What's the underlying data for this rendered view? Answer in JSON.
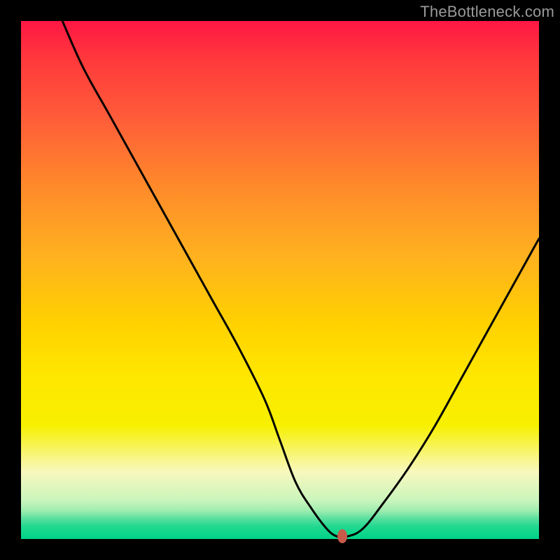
{
  "watermark": "TheBottleneck.com",
  "colors": {
    "frame": "#000000",
    "curve": "#000000",
    "marker": "#c85a4a",
    "gradient_top": "#ff1744",
    "gradient_bottom": "#00d488"
  },
  "chart_data": {
    "type": "line",
    "title": "",
    "xlabel": "",
    "ylabel": "",
    "xlim": [
      0,
      100
    ],
    "ylim": [
      0,
      100
    ],
    "grid": false,
    "x": [
      8,
      12,
      17,
      22,
      27,
      32,
      37,
      42,
      47,
      50,
      53,
      56,
      59,
      61,
      63,
      66,
      70,
      75,
      80,
      85,
      90,
      95,
      100
    ],
    "values": [
      100,
      91,
      82,
      73,
      64,
      55,
      46,
      37,
      27,
      19,
      11,
      6,
      2,
      0.5,
      0.5,
      2,
      7,
      14,
      22,
      31,
      40,
      49,
      58
    ],
    "marker": {
      "x": 62,
      "y": 0.5
    }
  }
}
